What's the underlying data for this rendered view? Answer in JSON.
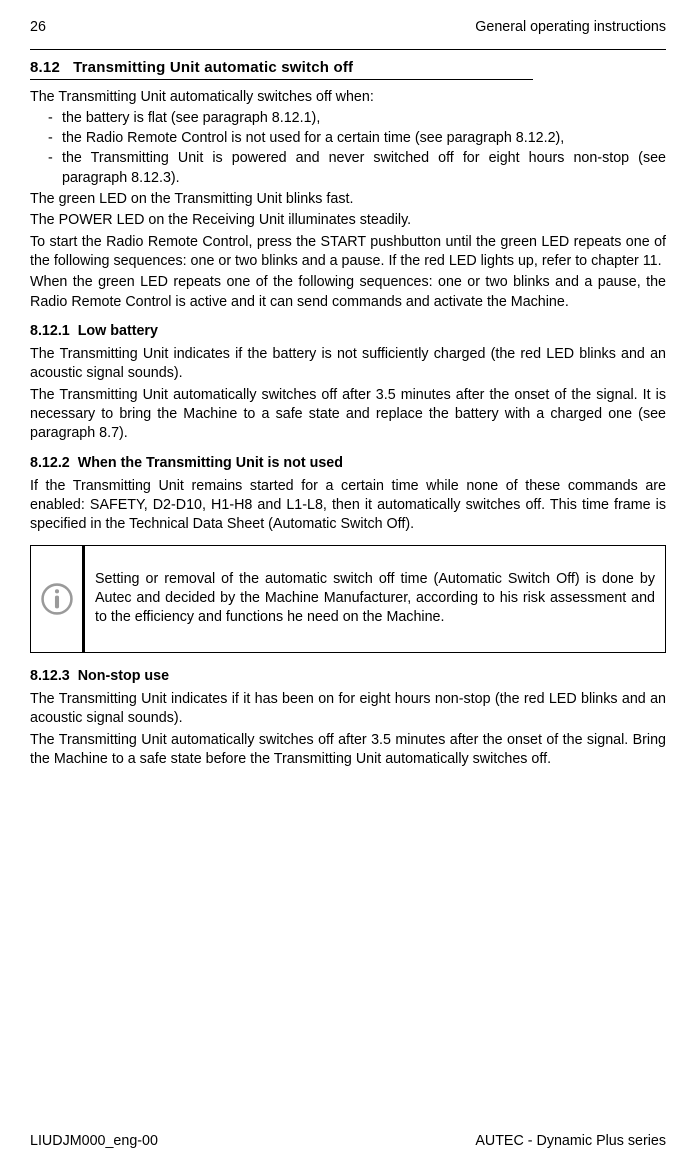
{
  "header": {
    "page": "26",
    "title": "General operating instructions"
  },
  "section": {
    "num": "8.12",
    "title": "Transmitting Unit automatic switch off"
  },
  "intro": "The Transmitting Unit automatically switches off when:",
  "bullets": [
    "the battery is flat (see paragraph 8.12.1),",
    "the Radio Remote Control is not used for a certain time (see paragraph 8.12.2),",
    "the Transmitting Unit is powered and never switched off for eight hours non-stop (see paragraph 8.12.3)."
  ],
  "post": [
    "The green LED on the Transmitting Unit blinks fast.",
    "The POWER LED on the Receiving Unit illuminates steadily.",
    "To start the Radio Remote Control, press the START pushbutton until the green LED repeats one of the following sequences: one or two blinks and a pause. If the red LED lights up, refer to chapter 11.",
    "When the green LED repeats one of the following sequences: one or two blinks and a pause, the Radio Remote Control is active and it can send commands and activate the Machine."
  ],
  "s1": {
    "num": "8.12.1",
    "title": "Low battery",
    "paras": [
      "The Transmitting Unit indicates if the battery is not sufficiently charged (the red LED blinks and an acoustic signal sounds).",
      "The Transmitting Unit automatically switches off after 3.5 minutes after the onset of the signal. It is necessary to bring the Machine to a safe state and replace the battery with a charged one (see paragraph 8.7)."
    ]
  },
  "s2": {
    "num": "8.12.2",
    "title": "When the Transmitting Unit is not used",
    "paras": [
      "If the Transmitting Unit remains started for a certain time while none of these commands are enabled: SAFETY, D2-D10, H1-H8 and L1-L8, then it automatically switches off. This time frame is specified in the Technical Data Sheet (Automatic Switch Off)."
    ],
    "note": "Setting or removal of the automatic switch off time (Automatic Switch Off) is done by Autec and decided by the Machine Manufacturer, according to his risk assessment and to the efficiency and functions he need on the Machine."
  },
  "s3": {
    "num": "8.12.3",
    "title": "Non-stop use",
    "paras": [
      "The Transmitting Unit indicates if it has been on for eight hours non-stop (the red LED blinks and an acoustic signal sounds).",
      "The Transmitting Unit automatically switches off after 3.5 minutes after the onset of the signal. Bring the Machine to a safe state before the Transmitting Unit automatically switches off."
    ]
  },
  "footer": {
    "left": "LIUDJM000_eng-00",
    "right": "AUTEC - Dynamic Plus series"
  }
}
